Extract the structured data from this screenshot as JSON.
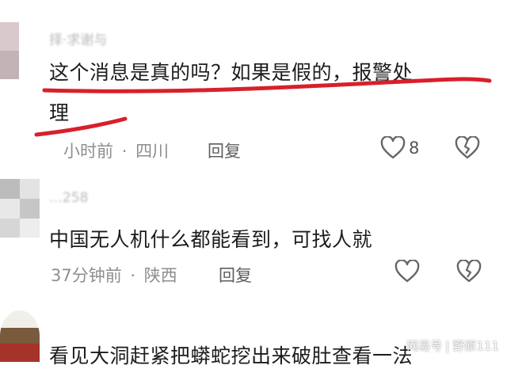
{
  "comments": [
    {
      "username": "择·求谢与",
      "text_line1": "这个消息是真的吗？如果是假的，报警处",
      "text_line2": "理",
      "time": "小时前",
      "dot": "·",
      "location": "四川",
      "reply_label": "回复",
      "like_count": "8",
      "like_icon": "heart-icon",
      "dislike_icon": "broken-heart-icon"
    },
    {
      "username": "…258",
      "text_line1": "中国无人机什么都能看到，可找人就",
      "time": "37分钟前",
      "dot": "·",
      "location": "陕西",
      "reply_label": "回复",
      "like_icon": "heart-icon",
      "dislike_icon": "broken-heart-icon"
    },
    {
      "text_line1": "看见大洞赶紧把蟒蛇挖出来破肚查看一法"
    }
  ],
  "watermark": {
    "brand": "网易号",
    "separator": "|",
    "author": "野原111"
  },
  "colors": {
    "annotation_red": "#d8202a",
    "meta_gray": "#8e8e8e",
    "text_dark": "#1c1c1c"
  }
}
